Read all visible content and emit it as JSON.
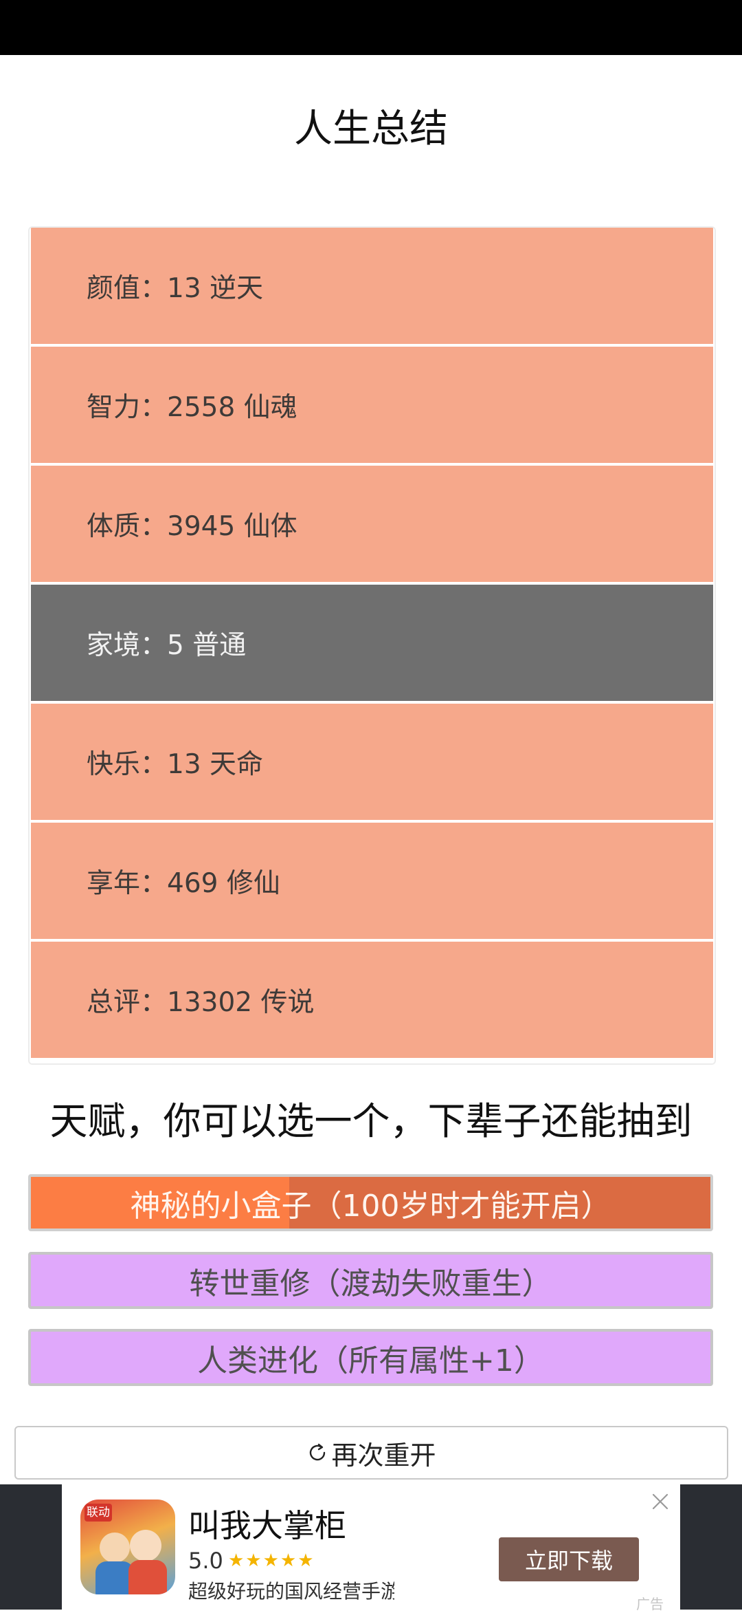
{
  "page": {
    "title": "人生总结"
  },
  "stats": [
    {
      "text": "颜值：13 逆天",
      "tone": "high"
    },
    {
      "text": "智力：2558 仙魂",
      "tone": "high"
    },
    {
      "text": "体质：3945 仙体",
      "tone": "high"
    },
    {
      "text": "家境：5 普通",
      "tone": "neutral"
    },
    {
      "text": "快乐：13 天命",
      "tone": "high"
    },
    {
      "text": "享年：469 修仙",
      "tone": "high"
    },
    {
      "text": "总评：13302 传说",
      "tone": "high"
    }
  ],
  "talents": {
    "heading": "天赋，你可以选一个，下辈子还能抽到",
    "items": [
      {
        "label": "神秘的小盒子（100岁时才能开启）",
        "selected": true,
        "progress": 0.38
      },
      {
        "label": "转世重修（渡劫失败重生）",
        "selected": false
      },
      {
        "label": "人类进化（所有属性+1）",
        "selected": false
      }
    ]
  },
  "restart": {
    "label": "再次重开"
  },
  "ad": {
    "icon_badge": "联动",
    "title": "叫我大掌柜",
    "rating": "5.0",
    "stars": "★★★★★",
    "description": "超级好玩的国风经营手游，运用...",
    "button": "立即下载",
    "label": "广告"
  },
  "colors": {
    "high_row": "#f6a88b",
    "neutral_row": "#6f6f6f",
    "talent_bg": "#e0a8fb",
    "selected_bg": "#db6b42",
    "selected_fill": "#fc7d44",
    "ad_button": "#7a5a50"
  }
}
